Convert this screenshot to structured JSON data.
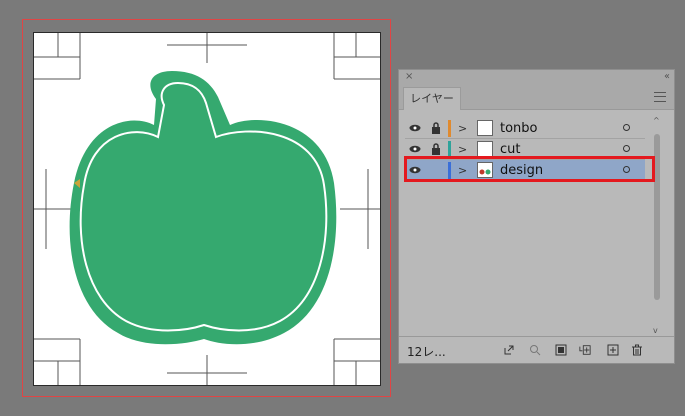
{
  "panel": {
    "close": "×",
    "collapse": "‹‹",
    "tab": "レイヤー",
    "menu_icon": "hamburger-menu-icon",
    "layers": [
      {
        "name": "tonbo",
        "visible": true,
        "locked": true,
        "color": "#e08a2e",
        "selected": false
      },
      {
        "name": "cut",
        "visible": true,
        "locked": true,
        "color": "#2fa39a",
        "selected": false
      },
      {
        "name": "design",
        "visible": true,
        "locked": false,
        "color": "#3a6fd8",
        "selected": true
      }
    ],
    "count": "12レ...",
    "footer_icons": [
      "export-icon",
      "search-icon",
      "clip-icon",
      "new-sublayer-icon",
      "new-layer-icon",
      "trash-icon"
    ]
  },
  "design": {
    "shape_fill": "#35a96f",
    "shape_outline": "#ffffff",
    "marker_color": "#c9a33a",
    "artboard_border": "#e04545"
  }
}
